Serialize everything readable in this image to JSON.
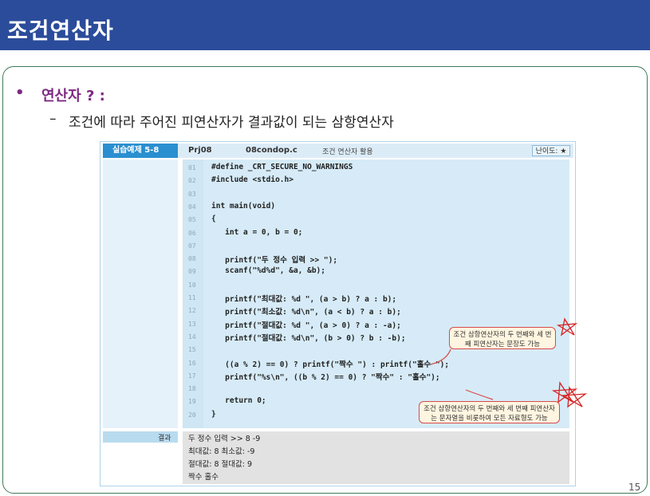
{
  "title": "조건연산자",
  "bullet": {
    "marker": "•",
    "text": "연산자 ? :"
  },
  "sub": {
    "marker": "–",
    "text": "조건에 따라 주어진 피연산자가 결과값이 되는 삼항연산자"
  },
  "example": {
    "label": "실습예제 5-8",
    "project": "Prj08",
    "file": "08condop.c",
    "desc": "조건 연산자 활용",
    "difficulty": "난이도: ★"
  },
  "code_lines": [
    {
      "n": "01",
      "t": "#define _CRT_SECURE_NO_WARNINGS"
    },
    {
      "n": "02",
      "t": "#include <stdio.h>"
    },
    {
      "n": "03",
      "t": ""
    },
    {
      "n": "04",
      "t": "int main(void)"
    },
    {
      "n": "05",
      "t": "{"
    },
    {
      "n": "06",
      "t": "   int a = 0, b = 0;"
    },
    {
      "n": "07",
      "t": ""
    },
    {
      "n": "08",
      "t": "   printf(\"두 정수 입력 >> \");"
    },
    {
      "n": "09",
      "t": "   scanf(\"%d%d\", &a, &b);"
    },
    {
      "n": "10",
      "t": ""
    },
    {
      "n": "11",
      "t": "   printf(\"최대값: %d \", (a > b) ? a : b);"
    },
    {
      "n": "12",
      "t": "   printf(\"최소값: %d\\n\", (a < b) ? a : b);"
    },
    {
      "n": "13",
      "t": "   printf(\"절대값: %d \", (a > 0) ? a : -a);"
    },
    {
      "n": "14",
      "t": "   printf(\"절대값: %d\\n\", (b > 0) ? b : -b);"
    },
    {
      "n": "15",
      "t": ""
    },
    {
      "n": "16",
      "t": "   ((a % 2) == 0) ? printf(\"짝수 \") : printf(\"홀수 \");"
    },
    {
      "n": "17",
      "t": "   printf(\"%s\\n\", ((b % 2) == 0) ? \"짝수\" : \"홀수\");"
    },
    {
      "n": "18",
      "t": ""
    },
    {
      "n": "19",
      "t": "   return 0;"
    },
    {
      "n": "20",
      "t": "}"
    }
  ],
  "result": {
    "label": "결과",
    "lines": [
      "두 정수 입력 >> 8 -9",
      "최대값: 8 최소값: -9",
      "절대값: 8 절대값: 9",
      "짝수 홀수"
    ]
  },
  "notes": [
    "조건 삼항연산자의 두 번째와 세 번째 피연산자는 문장도 가능",
    "조건 삼항연산자의 두 번째와 세 번째 피연산자는 문자열을 비롯하여 모든 자료형도 가능"
  ],
  "page_number": "15",
  "colors": {
    "title_bar": "#2b4c9b",
    "bullet": "#7d2a83",
    "label": "#2a8fd0"
  }
}
